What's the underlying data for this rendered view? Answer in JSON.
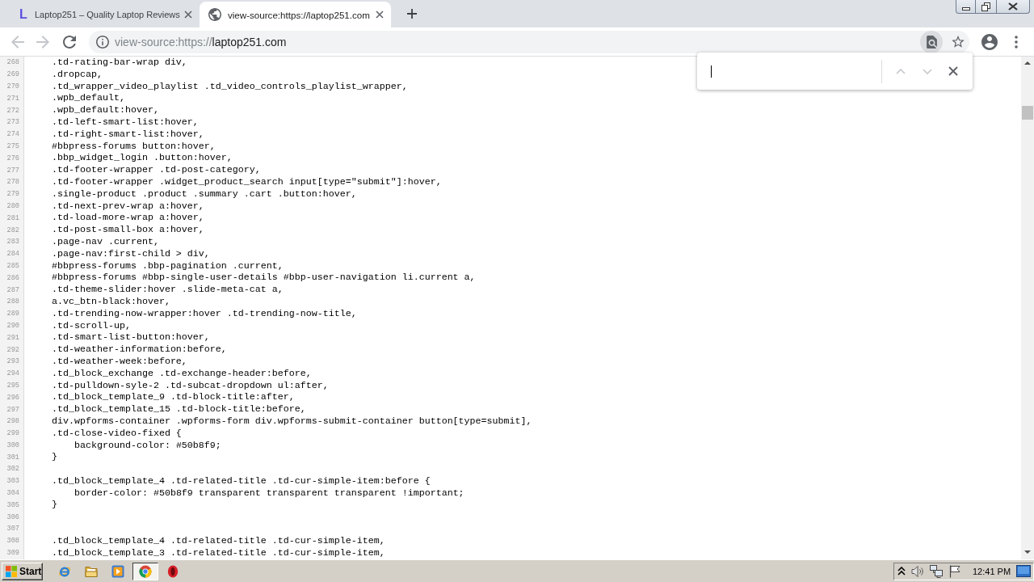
{
  "tabs": [
    {
      "favicon": {
        "kind": "letter",
        "text": "L"
      },
      "title": "Laptop251 – Quality Laptop Reviews",
      "selected": false
    },
    {
      "favicon": {
        "kind": "globe"
      },
      "title": "view-source:https://laptop251.com",
      "selected": true
    }
  ],
  "toolbar": {
    "nav_buttons": [
      {
        "kind": "back",
        "disabled": true
      },
      {
        "kind": "forward",
        "disabled": true
      },
      {
        "kind": "reload",
        "disabled": false
      }
    ],
    "address_bar": {
      "scheme": "view-source:https://",
      "host": "laptop251.com"
    }
  },
  "find_bar": {
    "buttons": [
      {
        "kind": "previous",
        "disabled": true
      },
      {
        "kind": "next",
        "disabled": true
      },
      {
        "kind": "close",
        "disabled": false
      }
    ]
  },
  "source": {
    "lines": [
      {
        "number": "268",
        "code": "    .td-rating-bar-wrap div,"
      },
      {
        "number": "269",
        "code": "    .dropcap,"
      },
      {
        "number": "270",
        "code": "    .td_wrapper_video_playlist .td_video_controls_playlist_wrapper,"
      },
      {
        "number": "271",
        "code": "    .wpb_default,"
      },
      {
        "number": "272",
        "code": "    .wpb_default:hover,"
      },
      {
        "number": "273",
        "code": "    .td-left-smart-list:hover,"
      },
      {
        "number": "274",
        "code": "    .td-right-smart-list:hover,"
      },
      {
        "number": "275",
        "code": "    #bbpress-forums button:hover,"
      },
      {
        "number": "276",
        "code": "    .bbp_widget_login .button:hover,"
      },
      {
        "number": "277",
        "code": "    .td-footer-wrapper .td-post-category,"
      },
      {
        "number": "278",
        "code": "    .td-footer-wrapper .widget_product_search input[type=\"submit\"]:hover,"
      },
      {
        "number": "279",
        "code": "    .single-product .product .summary .cart .button:hover,"
      },
      {
        "number": "280",
        "code": "    .td-next-prev-wrap a:hover,"
      },
      {
        "number": "281",
        "code": "    .td-load-more-wrap a:hover,"
      },
      {
        "number": "282",
        "code": "    .td-post-small-box a:hover,"
      },
      {
        "number": "283",
        "code": "    .page-nav .current,"
      },
      {
        "number": "284",
        "code": "    .page-nav:first-child > div,"
      },
      {
        "number": "285",
        "code": "    #bbpress-forums .bbp-pagination .current,"
      },
      {
        "number": "286",
        "code": "    #bbpress-forums #bbp-single-user-details #bbp-user-navigation li.current a,"
      },
      {
        "number": "287",
        "code": "    .td-theme-slider:hover .slide-meta-cat a,"
      },
      {
        "number": "288",
        "code": "    a.vc_btn-black:hover,"
      },
      {
        "number": "289",
        "code": "    .td-trending-now-wrapper:hover .td-trending-now-title,"
      },
      {
        "number": "290",
        "code": "    .td-scroll-up,"
      },
      {
        "number": "291",
        "code": "    .td-smart-list-button:hover,"
      },
      {
        "number": "292",
        "code": "    .td-weather-information:before,"
      },
      {
        "number": "293",
        "code": "    .td-weather-week:before,"
      },
      {
        "number": "294",
        "code": "    .td_block_exchange .td-exchange-header:before,"
      },
      {
        "number": "295",
        "code": "    .td-pulldown-syle-2 .td-subcat-dropdown ul:after,"
      },
      {
        "number": "296",
        "code": "    .td_block_template_9 .td-block-title:after,"
      },
      {
        "number": "297",
        "code": "    .td_block_template_15 .td-block-title:before,"
      },
      {
        "number": "298",
        "code": "    div.wpforms-container .wpforms-form div.wpforms-submit-container button[type=submit],"
      },
      {
        "number": "299",
        "code": "    .td-close-video-fixed {"
      },
      {
        "number": "300",
        "code": "        background-color: #50b8f9;"
      },
      {
        "number": "301",
        "code": "    }"
      },
      {
        "number": "302"
      },
      {
        "number": "303",
        "code": "    .td_block_template_4 .td-related-title .td-cur-simple-item:before {"
      },
      {
        "number": "304",
        "code": "        border-color: #50b8f9 transparent transparent transparent !important;"
      },
      {
        "number": "305",
        "code": "    }"
      },
      {
        "number": "306"
      },
      {
        "number": "307"
      },
      {
        "number": "308",
        "code": "    .td_block_template_4 .td-related-title .td-cur-simple-item,"
      },
      {
        "number": "309",
        "code": "    .td_block_template_3 .td-related-title .td-cur-simple-item,"
      }
    ]
  },
  "taskbar": {
    "start_label": "Start",
    "apps": [
      {
        "kind": "e-logo",
        "selected": false
      },
      {
        "kind": "folder",
        "selected": false
      },
      {
        "kind": "media",
        "selected": false
      },
      {
        "kind": "ring-logo",
        "selected": true
      },
      {
        "kind": "o-logo",
        "selected": false
      }
    ],
    "clock": "12:41 PM"
  }
}
